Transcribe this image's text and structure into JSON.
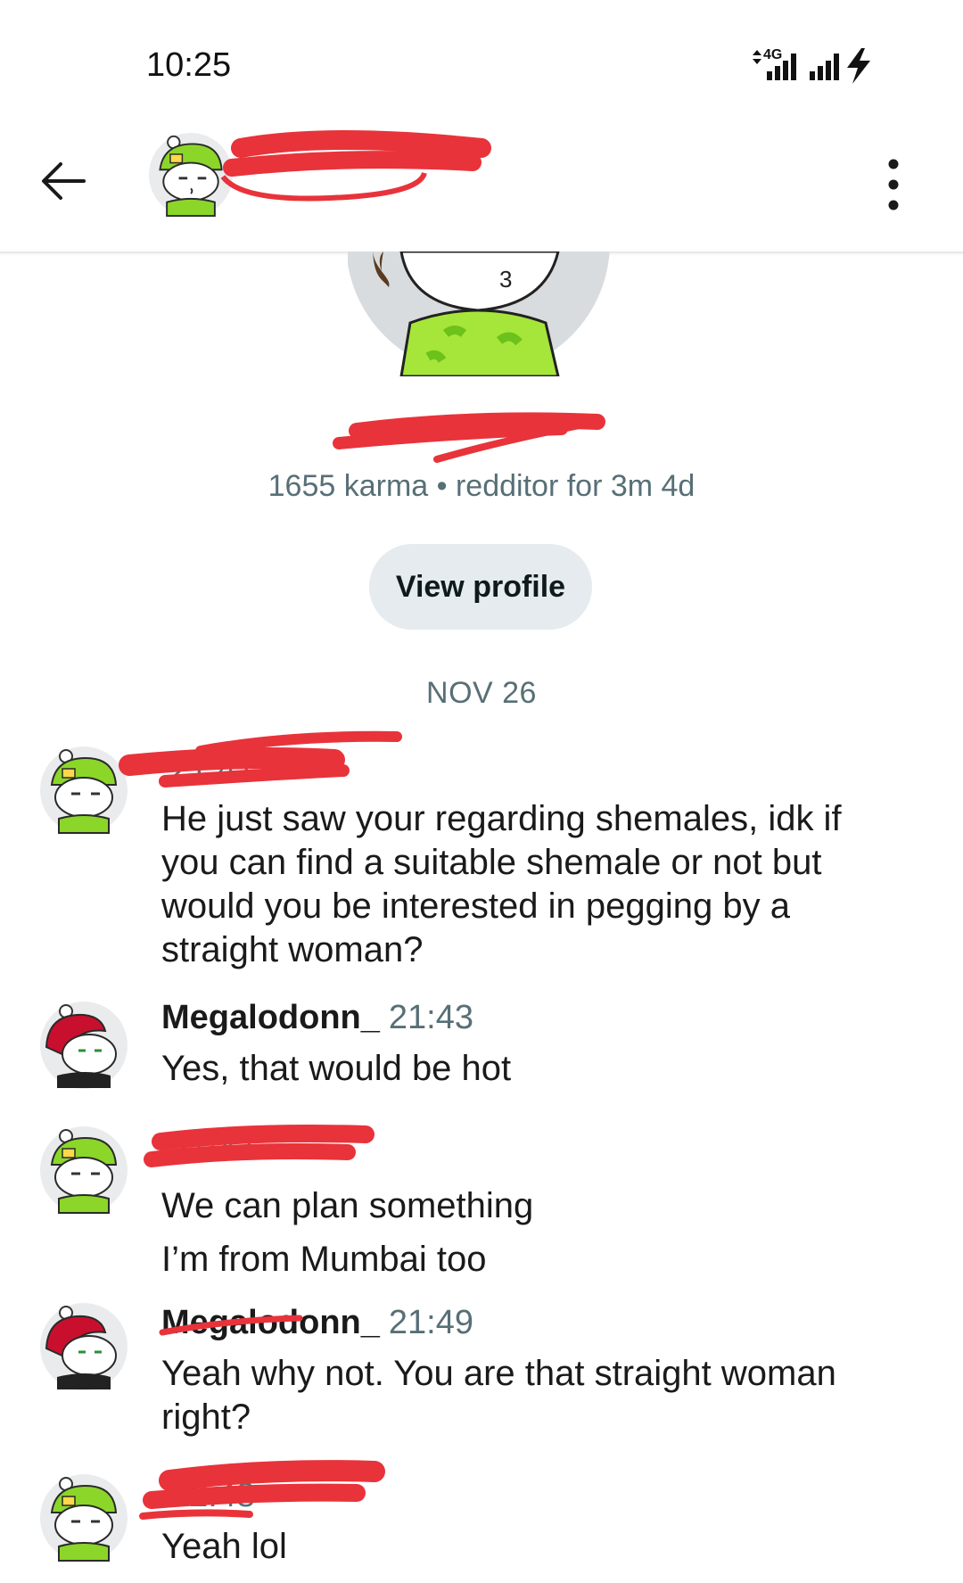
{
  "status_bar": {
    "time": "10:25",
    "network_label": "4G",
    "icons": [
      "data-arrows-icon",
      "signal-icon",
      "signal-icon",
      "charging-bolt-icon"
    ]
  },
  "header": {
    "back_icon": "back-arrow-icon",
    "username": "",
    "menu_icon": "more-vertical-icon"
  },
  "profile": {
    "username": "",
    "karma_line": "1655 karma • redditor for 3m 4d",
    "view_profile_label": "View profile"
  },
  "date_separator": "NOV 26",
  "messages": [
    {
      "author": "",
      "time": "21:41",
      "lines": [
        "He just saw your regarding shemales, idk if you can find a suitable shemale or not but would you be interested in pegging by a straight woman?"
      ]
    },
    {
      "author": "Megalodonn_",
      "time": "21:43",
      "lines": [
        "Yes, that would be hot"
      ]
    },
    {
      "author": "",
      "time": "21:47",
      "lines": [
        "We can plan something",
        "I’m from Mumbai too"
      ]
    },
    {
      "author": "Megalodonn_",
      "time": "21:49",
      "lines": [
        "Yeah why not. You are that straight woman right?"
      ]
    },
    {
      "author": "",
      "time": "22:48",
      "lines": [
        "Yeah lol"
      ]
    }
  ],
  "colors": {
    "redaction": "#e8333a",
    "meta_text": "#576f76",
    "button_bg": "#e5ebee",
    "avatar_green": "#8bd629",
    "avatar_red": "#c8102e"
  }
}
